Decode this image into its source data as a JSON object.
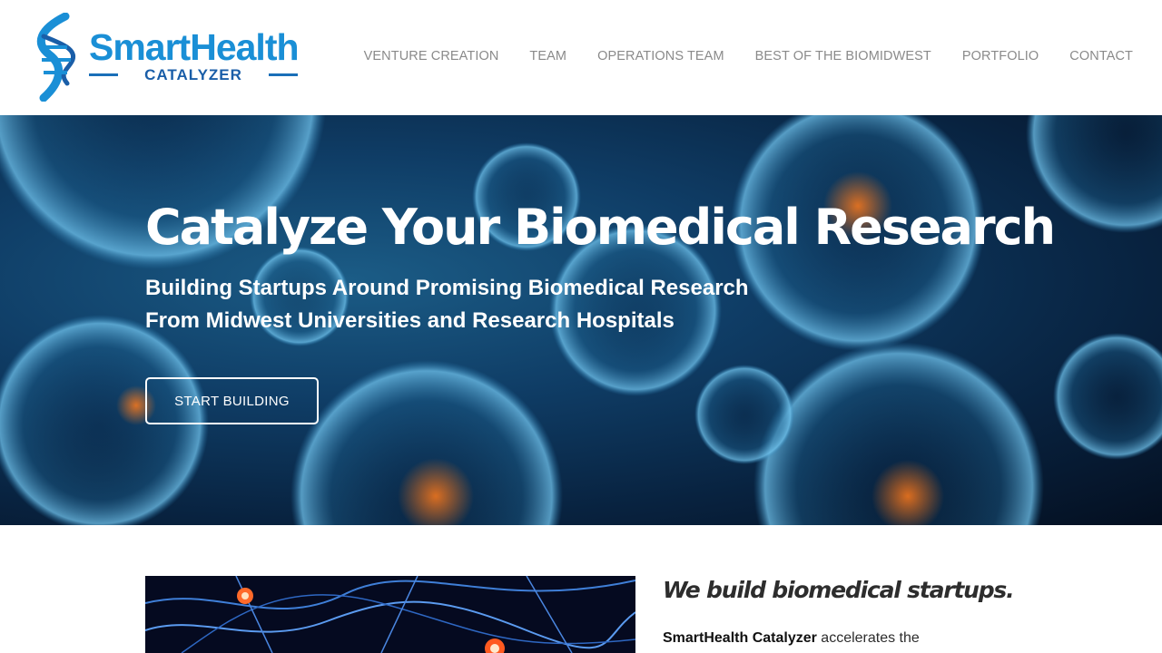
{
  "brand": {
    "name": "SmartHealth",
    "tagline": "CATALYZER"
  },
  "nav": {
    "items": [
      {
        "label": "VENTURE CREATION"
      },
      {
        "label": "TEAM"
      },
      {
        "label": "OPERATIONS TEAM"
      },
      {
        "label": "BEST OF THE BIOMIDWEST"
      },
      {
        "label": "PORTFOLIO"
      },
      {
        "label": "CONTACT"
      }
    ]
  },
  "hero": {
    "title": "Catalyze Your Biomedical Research",
    "subtitle": "Building Startups Around Promising Biomedical Research From Midwest Universities and Research Hospitals",
    "cta_label": "START BUILDING"
  },
  "intro": {
    "heading": "We build biomedical startups.",
    "company": "SmartHealth Catalyzer",
    "text_rest": " accelerates the"
  },
  "colors": {
    "brand_blue": "#1a8fd6",
    "brand_dark_blue": "#1a5ea8",
    "nav_text": "#8a8a8a",
    "hero_bg": "#0f3d66"
  }
}
